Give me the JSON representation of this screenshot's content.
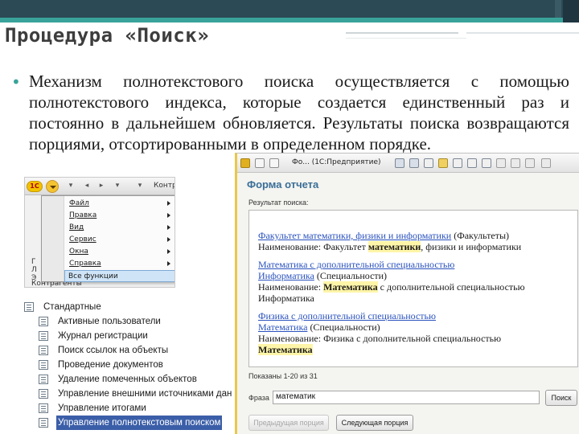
{
  "slide": {
    "title": "Процедура «Поиск»",
    "bullet": "•",
    "body": "Механизм полнотекстового поиска осуществляется с помощью полнотекстового индекса, которые создается единственный раз и постоянно в дальнейшем обновляется. Результаты поиска возвращаются порциями, отсортированными в определенном порядке."
  },
  "menu_screenshot": {
    "logo": "1С",
    "toolbar_right": "Контр",
    "items": [
      "Файл",
      "Правка",
      "Вид",
      "Сервис",
      "Окна",
      "Справка",
      "Все функции"
    ],
    "left_letters": [
      "Г",
      "Л",
      "Э"
    ],
    "kontragenty": "Контрагенты"
  },
  "tree": {
    "root": "Стандартные",
    "items": [
      "Активные пользователи",
      "Журнал регистрации",
      "Поиск ссылок на объекты",
      "Проведение документов",
      "Удаление помеченных объектов",
      "Управление внешними источниками дан",
      "Управление итогами",
      "Управление полнотекстовым поиском"
    ]
  },
  "window": {
    "title": "Фо... (1С:Предприятие)",
    "heading": "Форма отчета",
    "result_label": "Результат поиска:",
    "results": {
      "l1_link": "Факультет математики, физики и информатики",
      "l1_rest": " (Факультеты)",
      "l2_a": "Наименование: Факультет ",
      "l2_hl": "математики",
      "l2_b": ", физики и информатики",
      "l3_link": "Математика с дополнительной специальностью",
      "l4_link": "Информатика",
      "l4_rest": " (Специальности)",
      "l5_a": "Наименование: ",
      "l5_hl": "Математика",
      "l5_b": " с дополнительной специальностью",
      "l6": "Информатика",
      "l7_link": "Физика с дополнительной специальностью",
      "l8_link": "Математика",
      "l8_rest": " (Специальности)",
      "l9": "Наименование: Физика с дополнительной специальностью",
      "l10_hl": "Математика"
    },
    "shown": "Показаны 1-20 из 31",
    "phrase_label": "Фраза",
    "phrase_value": "математик",
    "search_button": "Поиск",
    "prev_button": "Предыдущая порция",
    "next_button": "Следующая порция"
  },
  "colors": {
    "accent_teal": "#39a39a",
    "header_dark": "#2c4a55",
    "link_blue": "#2a52be",
    "heading_blue": "#3a6e97",
    "highlight": "#fff5a8",
    "tree_selection": "#3b5ea8"
  }
}
